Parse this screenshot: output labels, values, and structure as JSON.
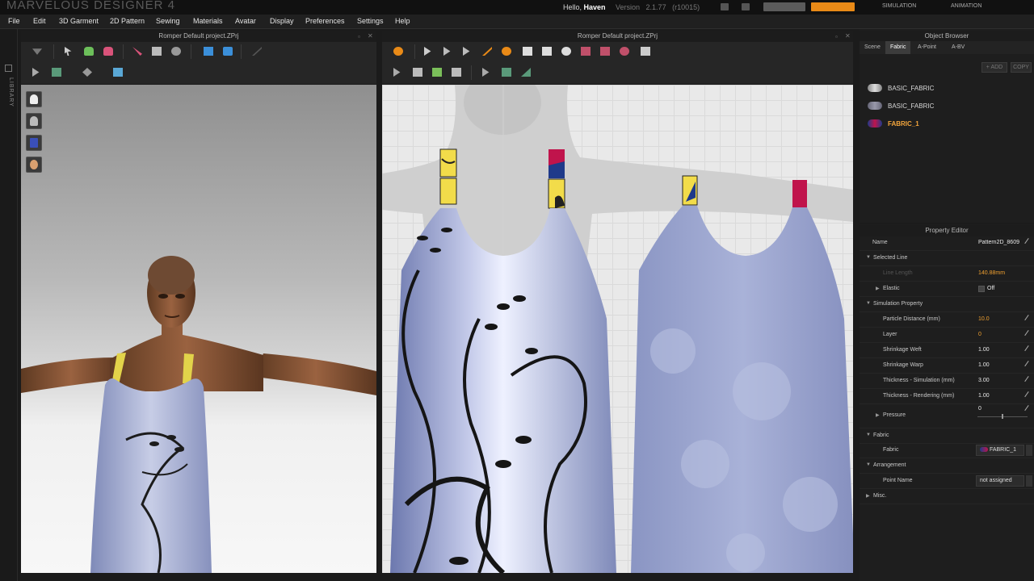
{
  "app": {
    "title": "MARVELOUS DESIGNER 4",
    "greeting_prefix": "Hello,",
    "user": "Haven",
    "version_label": "Version",
    "version": "2.1.77",
    "build": "(r10015)",
    "mode_tabs": [
      "SIMULATION",
      "ANIMATION"
    ]
  },
  "menu": [
    "File",
    "Edit",
    "3D Garment",
    "2D Pattern",
    "Sewing",
    "Materials",
    "Avatar",
    "Display",
    "Preferences",
    "Settings",
    "Help"
  ],
  "library": {
    "label": "LIBRARY"
  },
  "panel3d": {
    "title": "Romper Default project.ZPrj",
    "side_buttons": [
      "garment-view-icon",
      "avatar-view-icon",
      "texture-view-icon",
      "head-view-icon"
    ]
  },
  "panel2d": {
    "title": "Romper Default project.ZPrj"
  },
  "object_browser": {
    "title": "Object Browser",
    "tabs": [
      "Scene",
      "Fabric",
      "A-Point",
      "A-BV"
    ],
    "active_tab": "Fabric",
    "add_label": "ADD",
    "copy_label": "COPY",
    "fabrics": [
      {
        "name": "BASIC_FABRIC",
        "selected": false
      },
      {
        "name": "BASIC_FABRIC",
        "selected": false
      },
      {
        "name": "FABRIC_1",
        "selected": true
      }
    ]
  },
  "property_editor": {
    "title": "Property Editor",
    "name_label": "Name",
    "name_value": "Pattern2D_8609",
    "selected_line": {
      "header": "Selected Line",
      "line_length_label": "Line Length",
      "line_length_value": "140.88mm",
      "elastic_label": "Elastic",
      "elastic_value": "Off"
    },
    "simulation": {
      "header": "Simulation Property",
      "rows": [
        {
          "label": "Particle Distance (mm)",
          "value": "10.0",
          "highlight": true
        },
        {
          "label": "Layer",
          "value": "0",
          "highlight": true
        },
        {
          "label": "Shrinkage Weft",
          "value": "1.00",
          "highlight": false
        },
        {
          "label": "Shrinkage Warp",
          "value": "1.00",
          "highlight": false
        },
        {
          "label": "Thickness - Simulation (mm)",
          "value": "3.00",
          "highlight": false
        },
        {
          "label": "Thickness - Rendering (mm)",
          "value": "1.00",
          "highlight": false
        }
      ],
      "pressure_label": "Pressure",
      "pressure_value": "0"
    },
    "fabric": {
      "header": "Fabric",
      "label": "Fabric",
      "value": "FABRIC_1"
    },
    "arrangement": {
      "header": "Arrangement",
      "point_name_label": "Point Name",
      "point_name_value": "not assigned"
    },
    "misc_header": "Misc."
  },
  "colors": {
    "accent_orange": "#e98a17",
    "selected_text": "#f3a53c",
    "fabric_blue": "#9aa6cf",
    "yellow_tab": "#f2dc4a",
    "red_tab": "#c0144c"
  }
}
